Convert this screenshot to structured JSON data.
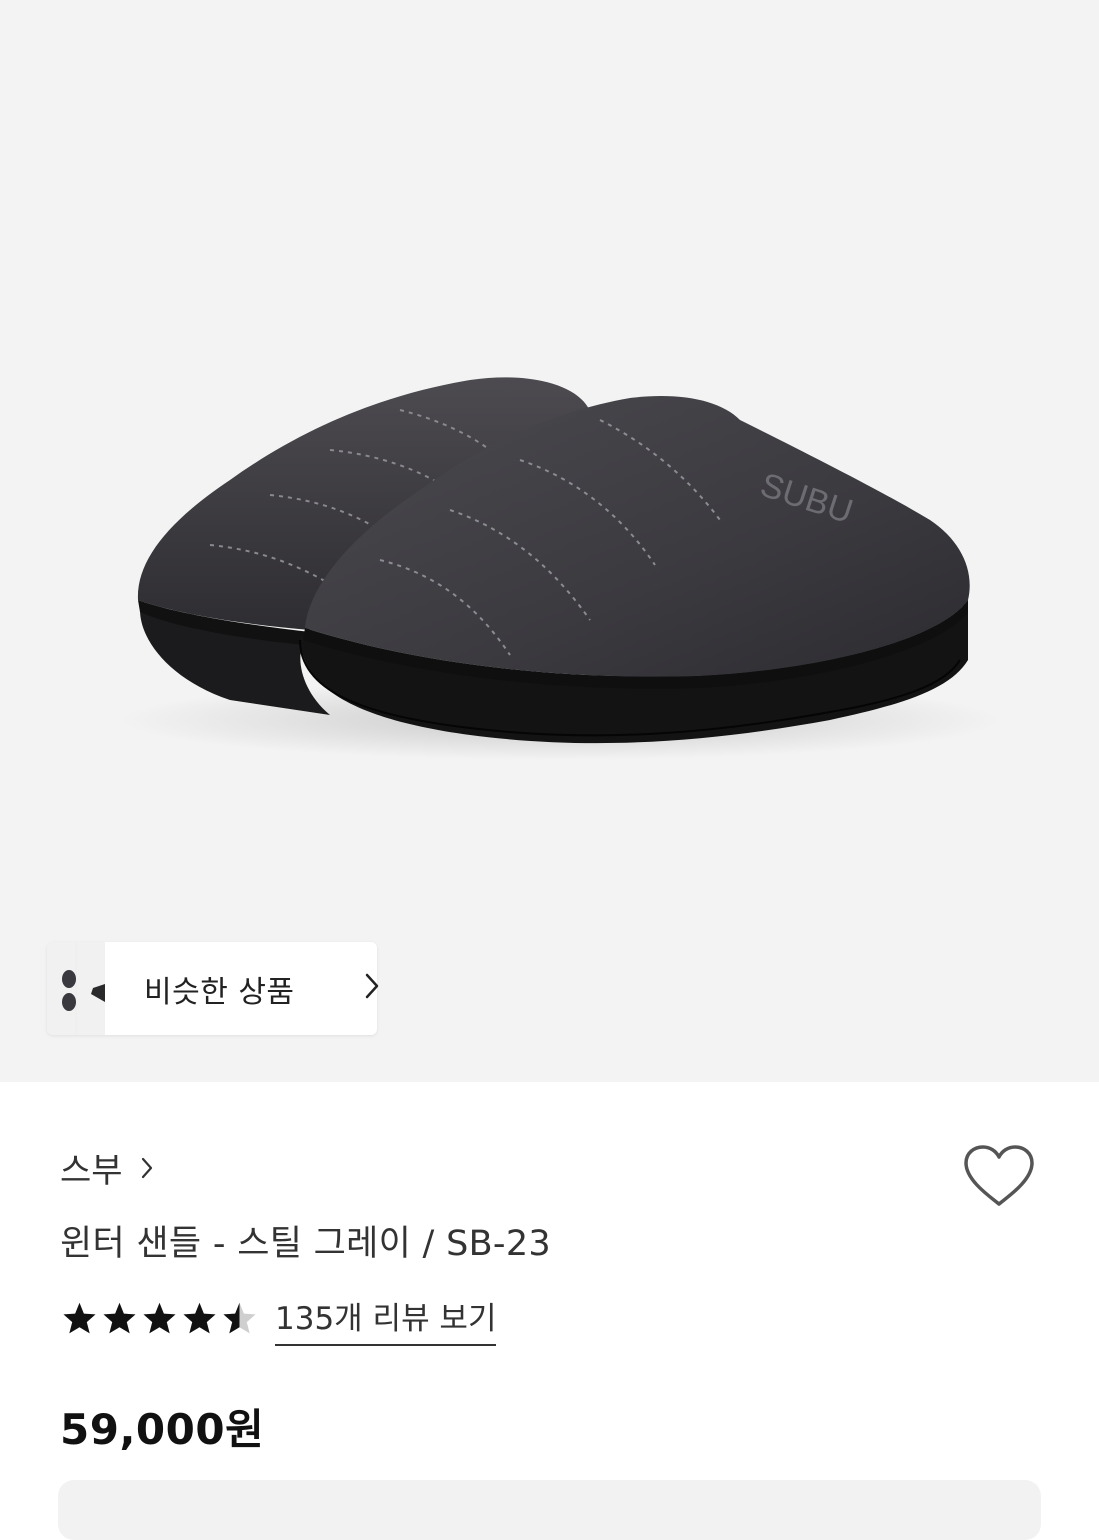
{
  "product_image": {
    "brand_logo": "SUBU",
    "description_icon": "winter-slipper-photo"
  },
  "similar_products": {
    "label": "비슷한 상품"
  },
  "brand": {
    "name": "스부"
  },
  "product": {
    "name": "윈터 샌들 - 스틸 그레이 / SB-23"
  },
  "rating": {
    "stars": 4.5,
    "max": 5,
    "review_link": "135개 리뷰 보기"
  },
  "price": {
    "value": "59,000원"
  },
  "colors": {
    "hero_bg": "#f3f3f3",
    "text": "#333333",
    "price": "#111111"
  }
}
